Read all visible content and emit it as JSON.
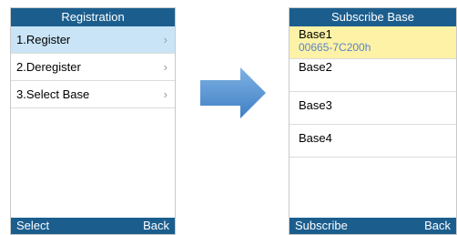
{
  "left_screen": {
    "title": "Registration",
    "items": [
      {
        "label": "1.Register",
        "chevron": "›"
      },
      {
        "label": "2.Deregister",
        "chevron": "›"
      },
      {
        "label": "3.Select Base",
        "chevron": "›"
      }
    ],
    "softkeys": {
      "left": "Select",
      "right": "Back"
    }
  },
  "right_screen": {
    "title": "Subscribe Base",
    "bases": [
      {
        "name": "Base1",
        "id": "00665-7C200h"
      },
      {
        "name": "Base2"
      },
      {
        "name": "Base3"
      },
      {
        "name": "Base4"
      }
    ],
    "softkeys": {
      "left": "Subscribe",
      "right": "Back"
    }
  },
  "colors": {
    "titlebar": "#1b5e8e",
    "selected_item_left": "#c9e4f6",
    "selected_item_right": "#fdf2a6",
    "arrow": "#5b9bd5"
  }
}
